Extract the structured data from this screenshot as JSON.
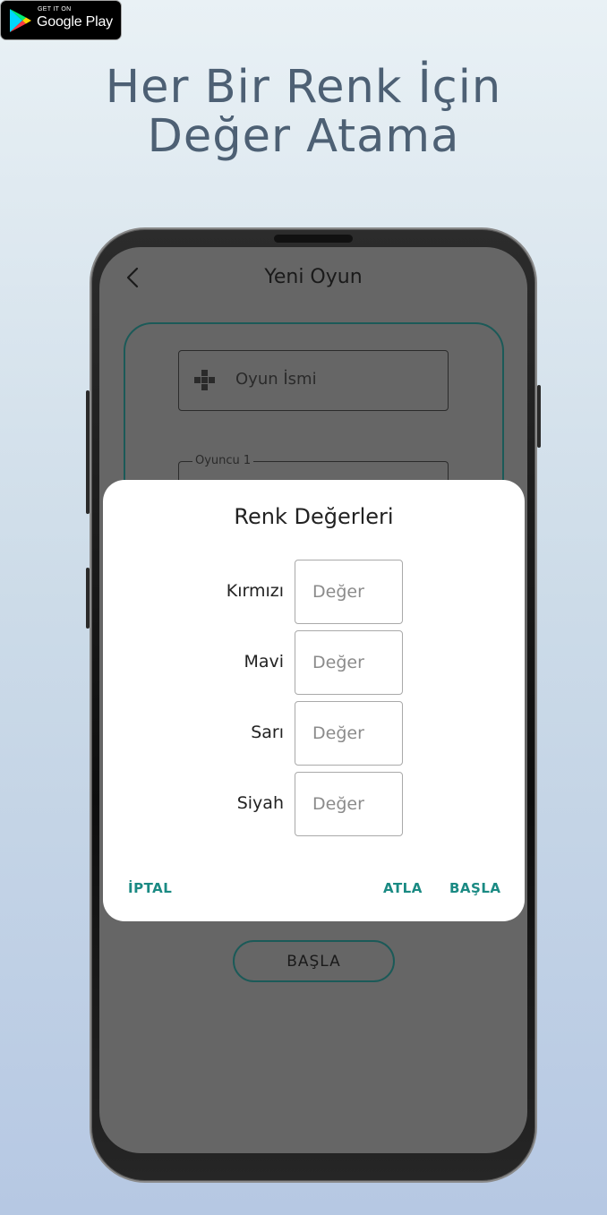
{
  "badge": {
    "small_text": "GET IT ON",
    "store_name": "Google Play"
  },
  "headline": {
    "line1": "Her Bir Renk İçin",
    "line2": "Değer Atama"
  },
  "screen": {
    "title": "Yeni Oyun",
    "game_name_placeholder": "Oyun İsmi",
    "player_label": "Oyuncu 1",
    "start_button": "BAŞLA"
  },
  "dialog": {
    "title": "Renk Değerleri",
    "rows": [
      {
        "label": "Kırmızı",
        "placeholder": "Değer"
      },
      {
        "label": "Mavi",
        "placeholder": "Değer"
      },
      {
        "label": "Sarı",
        "placeholder": "Değer"
      },
      {
        "label": "Siyah",
        "placeholder": "Değer"
      }
    ],
    "actions": {
      "cancel": "İPTAL",
      "skip": "ATLA",
      "start": "BAŞLA"
    }
  },
  "colors": {
    "accent": "#1a8a83",
    "card_border": "#1b5a58",
    "headline": "#4d6074",
    "overlay_screen": "#666666"
  }
}
